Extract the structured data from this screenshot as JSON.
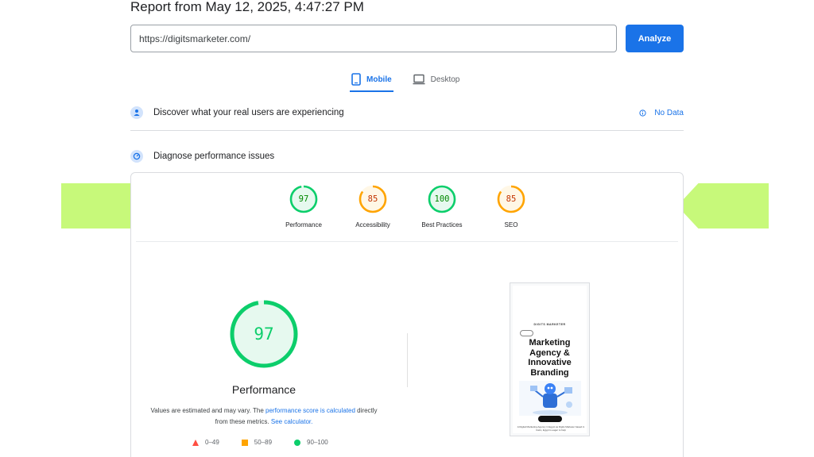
{
  "header": {
    "report_title": "Report from May 12, 2025, 4:47:27 PM"
  },
  "search": {
    "url_value": "https://digitsmarketer.com/",
    "analyze_label": "Analyze"
  },
  "device_tabs": [
    {
      "label": "Mobile",
      "active": true,
      "icon": "smartphone-icon"
    },
    {
      "label": "Desktop",
      "active": false,
      "icon": "laptop-icon"
    }
  ],
  "sections": {
    "cwv": {
      "label": "Discover what your real users are experiencing",
      "status": "No Data",
      "icon": "users-icon",
      "status_icon": "info-icon"
    },
    "diagnose": {
      "label": "Diagnose performance issues",
      "icon": "gauge-icon"
    }
  },
  "scores": [
    {
      "label": "Performance",
      "score": 97,
      "color": "#0cce6b"
    },
    {
      "label": "Accessibility",
      "score": 85,
      "color": "#ffa400"
    },
    {
      "label": "Best Practices",
      "score": 100,
      "color": "#0cce6b"
    },
    {
      "label": "SEO",
      "score": 85,
      "color": "#ffa400"
    }
  ],
  "main_score": {
    "label": "Performance",
    "score": 97,
    "color": "#0cce6b"
  },
  "disclaimer": {
    "part1": "Values are estimated and may vary. The ",
    "link1": "performance score is calculated",
    "part2": " directly from these metrics. ",
    "link2": "See calculator."
  },
  "legend": [
    {
      "range": "0–49",
      "shape": "triangle",
      "color": "#ff4e42"
    },
    {
      "range": "50–89",
      "shape": "square",
      "color": "#ffa400"
    },
    {
      "range": "90–100",
      "shape": "circle",
      "color": "#0cce6b"
    }
  ],
  "screenshot": {
    "brand": "DIGITS MARKETER",
    "headline": "Marketing Agency & Innovative Branding",
    "footer": "A Digital Marketing Agency in Egypt as Digits Marketer based in Cairo, Egypt is eager to help"
  },
  "colors": {
    "accent": "#1a73e8",
    "pass": "#0cce6b",
    "average": "#ffa400",
    "fail": "#ff4e42",
    "highlight": "#c7f97a"
  }
}
